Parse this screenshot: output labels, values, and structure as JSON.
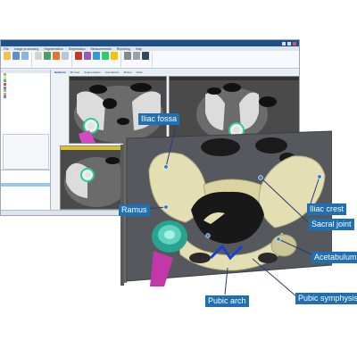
{
  "window": {
    "menu": [
      "File",
      "Image processing",
      "Segmentation",
      "Registration",
      "Measurements",
      "Reporting",
      "Help"
    ],
    "view_tabs": [
      "Sections",
      "3D view",
      "Segmentation",
      "Annotations",
      "Motion",
      "Draw"
    ],
    "status_left": "",
    "status_mid": "",
    "status_right": ""
  },
  "annotations": {
    "iliac_fossa": "Iliac fossa",
    "ramus": "Ramus",
    "iliac_crest": "Iliac crest",
    "sacral_joint": "Sacral joint",
    "acetabulum": "Acetabulum",
    "pubic_arch": "Pubic arch",
    "pubic_symphysis": "Pubic symphysis"
  },
  "colors": {
    "label_bg": "#1f6fb2",
    "bone": "#e3dfb2",
    "stem": "#c338a8",
    "cup": "#27a38f",
    "pubic_arch_line": "#1a3fd6",
    "leader_line": "#2a3a7c"
  }
}
